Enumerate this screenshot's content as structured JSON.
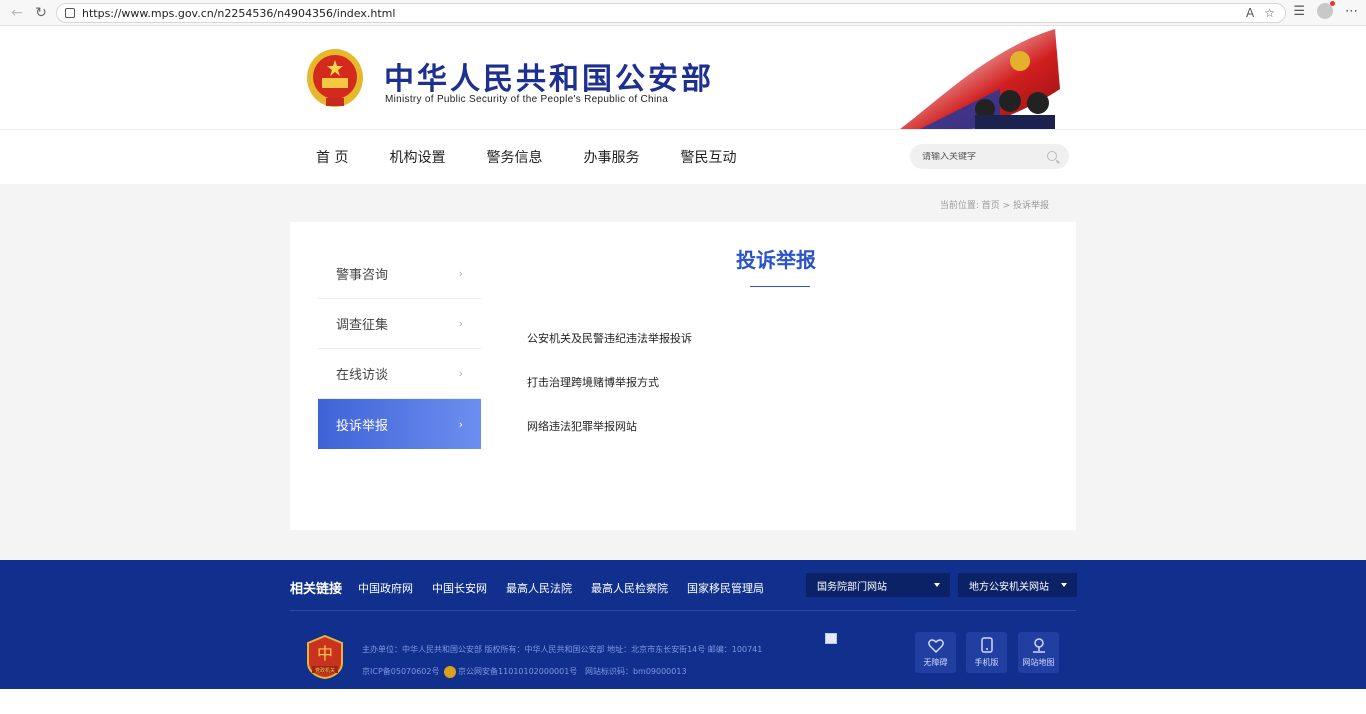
{
  "browser": {
    "url": "https://www.mps.gov.cn/n2254536/n4904356/index.html"
  },
  "header": {
    "title": "中华人民共和国公安部",
    "subtitle": "Ministry of Public Security of the People's Republic of China"
  },
  "nav": {
    "items": [
      "首 页",
      "机构设置",
      "警务信息",
      "办事服务",
      "警民互动"
    ],
    "search_placeholder": "请输入关键字"
  },
  "breadcrumb": "当前位置: 首页 > 投诉举报",
  "sidebar": {
    "items": [
      {
        "label": "警事咨询",
        "active": false
      },
      {
        "label": "调查征集",
        "active": false
      },
      {
        "label": "在线访谈",
        "active": false
      },
      {
        "label": "投诉举报",
        "active": true
      }
    ]
  },
  "content": {
    "heading": "投诉举报",
    "links": [
      "公安机关及民警违纪违法举报投诉",
      "打击治理跨境赌博举报方式",
      "网络违法犯罪举报网站"
    ]
  },
  "footer": {
    "related_title": "相关链接",
    "related_links": [
      "中国政府网",
      "中国长安网",
      "最高人民法院",
      "最高人民检察院",
      "国家移民管理局"
    ],
    "dropdown1": "国务院部门网站",
    "dropdown2": "地方公安机关网站",
    "info_line1": "主办单位：中华人民共和国公安部   版权所有：中华人民共和国公安部   地址：北京市东长安街14号   邮编：100741",
    "icp": "京ICP备05070602号",
    "police_record": "京公网安备11010102000001号",
    "site_code": "网站标识码：bm09000013",
    "badge_text": "党政机关",
    "tools": [
      "无障碍",
      "手机版",
      "网站地图"
    ]
  },
  "colors": {
    "brand_blue": "#1d2f8f",
    "accent_blue": "#2b54cc",
    "footer_bg": "#11308e"
  }
}
